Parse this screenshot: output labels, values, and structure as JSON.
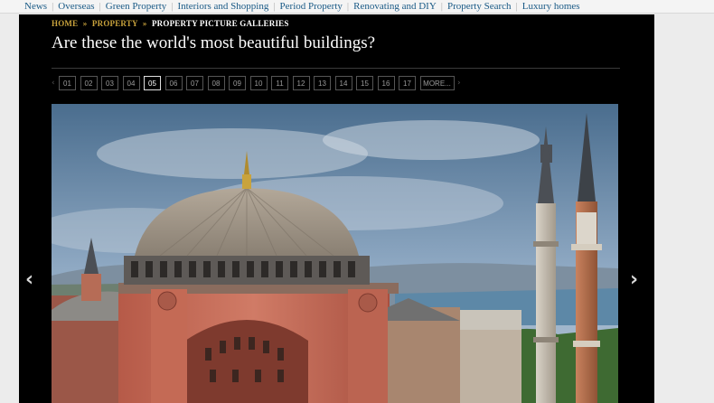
{
  "topnav": {
    "items": [
      "News",
      "Overseas",
      "Green Property",
      "Interiors and Shopping",
      "Period Property",
      "Renovating and DIY",
      "Property Search",
      "Luxury homes"
    ]
  },
  "breadcrumb": {
    "home": "HOME",
    "property": "PROPERTY",
    "current": "PROPERTY PICTURE GALLERIES",
    "separator": "»"
  },
  "gallery": {
    "title": "Are these the world's most beautiful buildings?",
    "pages": [
      "01",
      "02",
      "03",
      "04",
      "05",
      "06",
      "07",
      "08",
      "09",
      "10",
      "11",
      "12",
      "13",
      "14",
      "15",
      "16",
      "17"
    ],
    "active_page": "05",
    "more_label": "MORE...",
    "prev_small": "‹",
    "next_small": "›",
    "prev_large": "‹",
    "next_large": "›"
  },
  "colors": {
    "link": "#1a5a86",
    "breadcrumb": "#c9a33c",
    "panel": "#000000"
  }
}
